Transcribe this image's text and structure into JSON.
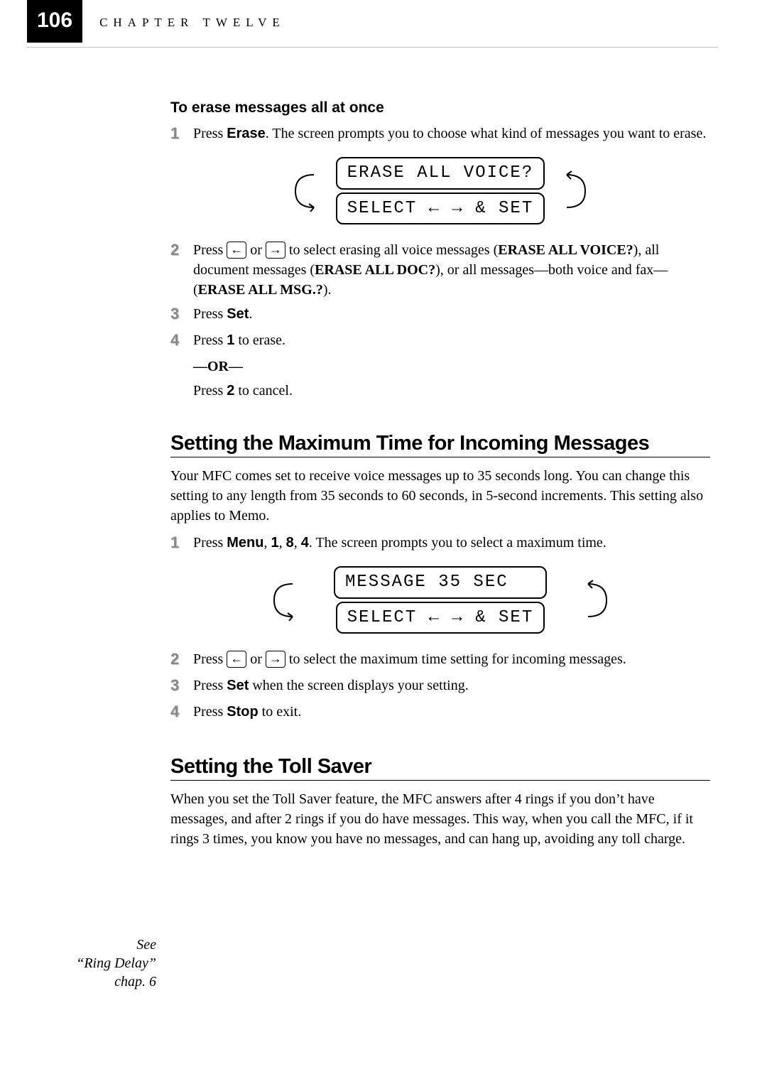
{
  "header": {
    "page_number": "106",
    "chapter_label": "CHAPTER TWELVE"
  },
  "margin_note": {
    "line1": "See",
    "line2": "“Ring Delay”",
    "line3": "chap. 6"
  },
  "sec1": {
    "heading": "To erase messages all at once",
    "step1_a": "Press ",
    "step1_erase": "Erase",
    "step1_b": ". The screen prompts you to choose what kind of messages you want to erase.",
    "lcd_top": "ERASE ALL VOICE?",
    "lcd_bot": "SELECT ← → & SET",
    "step2_a": "Press ",
    "step2_or": " or ",
    "step2_b": " to select erasing all voice messages (",
    "step2_opt1": "ERASE ALL VOICE?",
    "step2_c": "), all document messages (",
    "step2_opt2": "ERASE ALL DOC?",
    "step2_d": "), or all messages—both voice and fax—(",
    "step2_opt3": "ERASE ALL MSG.?",
    "step2_e": ").",
    "step3_a": "Press ",
    "step3_set": "Set",
    "step3_b": ".",
    "step4_a": "Press ",
    "step4_one": "1",
    "step4_b": " to erase.",
    "or": "—OR—",
    "step4_c": "Press ",
    "step4_two": "2",
    "step4_d": " to cancel."
  },
  "sec2": {
    "heading": "Setting the Maximum Time for Incoming Messages",
    "intro": "Your MFC comes set to receive voice messages up to 35 seconds long. You can change this setting to any length from 35 seconds to 60 seconds, in 5-second increments. This setting also applies to Memo.",
    "step1_a": "Press ",
    "step1_menu": "Menu",
    "step1_c1": ", ",
    "step1_one": "1",
    "step1_c2": ", ",
    "step1_eight": "8",
    "step1_c3": ", ",
    "step1_four": "4",
    "step1_b": ". The screen prompts you to select a maximum time.",
    "lcd_top": "MESSAGE 35 SEC",
    "lcd_bot": "SELECT ← → & SET",
    "step2_a": "Press ",
    "step2_or": " or ",
    "step2_b": " to select the maximum time setting for incoming messages.",
    "step3_a": "Press ",
    "step3_set": "Set",
    "step3_b": " when the screen displays your setting.",
    "step4_a": "Press ",
    "step4_stop": "Stop",
    "step4_b": " to exit."
  },
  "sec3": {
    "heading": "Setting the Toll Saver",
    "intro": "When you set the Toll Saver feature, the MFC answers after 4 rings if you don’t have messages, and after 2 rings if you do have messages. This way, when you call the MFC, if it rings 3 times, you know you have no messages, and can hang up, avoiding any toll charge."
  },
  "nums": {
    "n1": "1",
    "n2": "2",
    "n3": "3",
    "n4": "4"
  },
  "arrows": {
    "left": "←",
    "right": "→"
  }
}
